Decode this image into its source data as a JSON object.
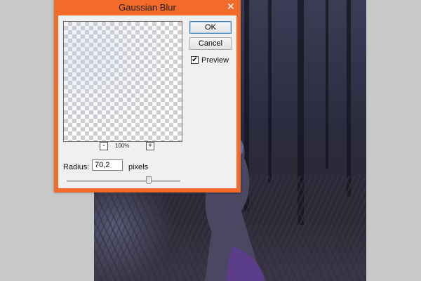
{
  "dialog": {
    "title": "Gaussian Blur",
    "close_glyph": "✕",
    "buttons": {
      "ok_label": "OK",
      "cancel_label": "Cancel"
    },
    "preview": {
      "label": "Preview",
      "checked": true,
      "check_glyph": "✔"
    },
    "zoom": {
      "minus_glyph": "-",
      "plus_glyph": "+",
      "level": "100%"
    },
    "radius": {
      "label": "Radius:",
      "value": "70,2",
      "units": "pixels",
      "slider_fraction": 0.72
    }
  },
  "colors": {
    "title_bar": "#f26b2a",
    "dialog_body": "#f0f0f0",
    "app_background": "#c7c9c8",
    "photo_tone": "#2b2c3f"
  },
  "icons": {
    "close": "close-icon",
    "preview_checkbox": "checkmark-icon",
    "zoom_out": "minus-icon",
    "zoom_in": "plus-icon"
  }
}
